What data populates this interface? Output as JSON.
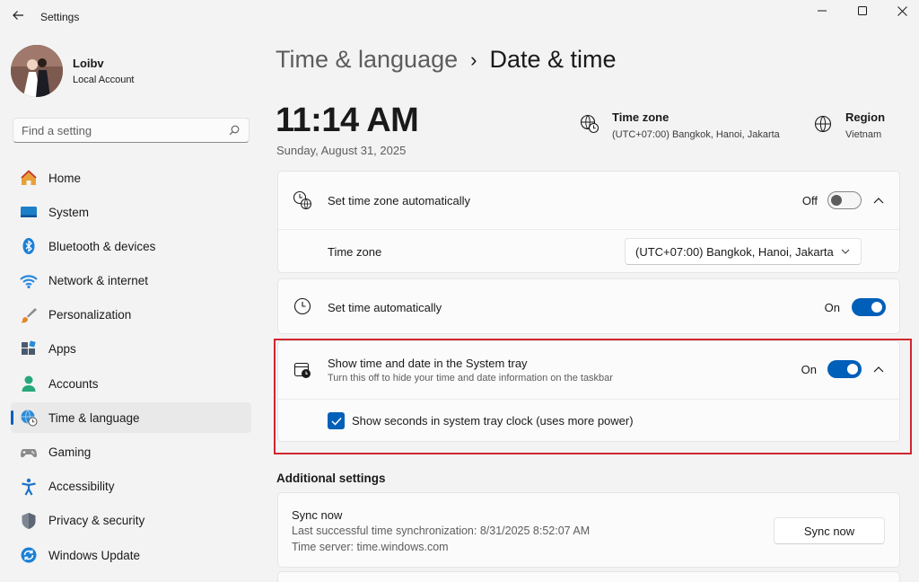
{
  "window": {
    "title": "Settings"
  },
  "profile": {
    "name": "Loibv",
    "account_type": "Local Account"
  },
  "search": {
    "placeholder": "Find a setting"
  },
  "sidebar": {
    "items": [
      {
        "label": "Home",
        "icon": "home-icon"
      },
      {
        "label": "System",
        "icon": "system-icon"
      },
      {
        "label": "Bluetooth & devices",
        "icon": "bluetooth-icon"
      },
      {
        "label": "Network & internet",
        "icon": "wifi-icon"
      },
      {
        "label": "Personalization",
        "icon": "brush-icon"
      },
      {
        "label": "Apps",
        "icon": "apps-icon"
      },
      {
        "label": "Accounts",
        "icon": "accounts-icon"
      },
      {
        "label": "Time & language",
        "icon": "globe-clock-icon",
        "active": true
      },
      {
        "label": "Gaming",
        "icon": "gamepad-icon"
      },
      {
        "label": "Accessibility",
        "icon": "accessibility-icon"
      },
      {
        "label": "Privacy & security",
        "icon": "shield-icon"
      },
      {
        "label": "Windows Update",
        "icon": "update-icon"
      }
    ]
  },
  "breadcrumb": {
    "parent": "Time & language",
    "separator": "›",
    "current": "Date & time"
  },
  "clock": {
    "time": "11:14 AM",
    "date": "Sunday, August 31, 2025"
  },
  "timezone_info": {
    "title": "Time zone",
    "value": "(UTC+07:00) Bangkok, Hanoi, Jakarta"
  },
  "region_info": {
    "title": "Region",
    "value": "Vietnam"
  },
  "settings": {
    "auto_timezone": {
      "label": "Set time zone automatically",
      "state": "Off"
    },
    "timezone": {
      "label": "Time zone",
      "selected": "(UTC+07:00) Bangkok, Hanoi, Jakarta"
    },
    "auto_time": {
      "label": "Set time automatically",
      "state": "On"
    },
    "tray": {
      "label": "Show time and date in the System tray",
      "description": "Turn this off to hide your time and date information on the taskbar",
      "state": "On"
    },
    "seconds": {
      "label": "Show seconds in system tray clock (uses more power)",
      "checked": true
    }
  },
  "additional": {
    "title": "Additional settings",
    "sync": {
      "title": "Sync now",
      "last_sync": "Last successful time synchronization: 8/31/2025 8:52:07 AM",
      "server": "Time server: time.windows.com",
      "button": "Sync now"
    }
  },
  "colors": {
    "accent": "#005fb8",
    "highlight_border": "#d0262f",
    "background": "#f3f3f3"
  }
}
